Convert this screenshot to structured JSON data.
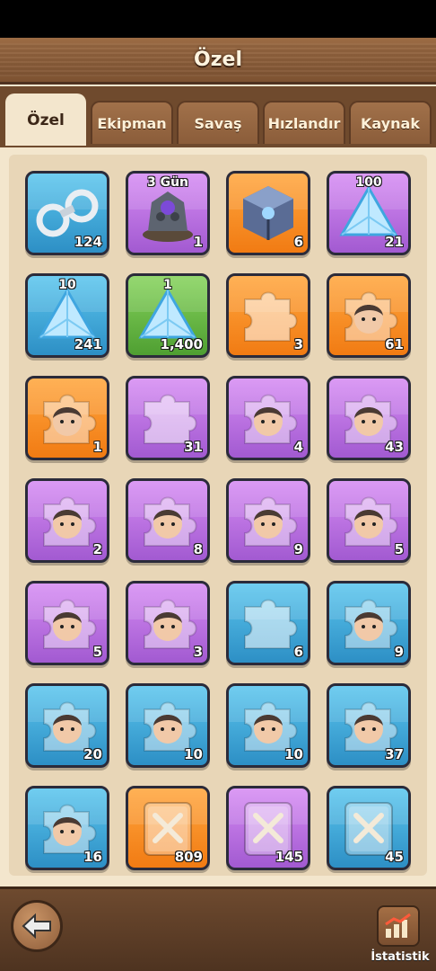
{
  "header": {
    "title": "Özel"
  },
  "tabs": [
    {
      "label": "Özel",
      "active": true
    },
    {
      "label": "Ekipman",
      "active": false
    },
    {
      "label": "Savaş",
      "active": false
    },
    {
      "label": "Hızlandır",
      "active": false
    },
    {
      "label": "Kaynak",
      "active": false
    }
  ],
  "items": [
    {
      "icon": "handcuffs-icon",
      "rarity": "blue",
      "top": "",
      "count": "124"
    },
    {
      "icon": "stone-golem-icon",
      "rarity": "purple",
      "top": "3 Gün",
      "count": "1"
    },
    {
      "icon": "mystery-cube-icon",
      "rarity": "orange",
      "top": "",
      "count": "6"
    },
    {
      "icon": "crystal-icon",
      "rarity": "purple",
      "top": "100",
      "count": "21"
    },
    {
      "icon": "crystal-icon",
      "rarity": "blue",
      "top": "10",
      "count": "241"
    },
    {
      "icon": "crystal-icon",
      "rarity": "green",
      "top": "1",
      "count": "1,400"
    },
    {
      "icon": "puzzle-piece-icon",
      "rarity": "orange",
      "top": "",
      "count": "3"
    },
    {
      "icon": "hero-shard-icon",
      "rarity": "orange",
      "top": "",
      "count": "61"
    },
    {
      "icon": "hero-shard-icon",
      "rarity": "orange",
      "top": "",
      "count": "1"
    },
    {
      "icon": "puzzle-piece-icon",
      "rarity": "purple",
      "top": "",
      "count": "31"
    },
    {
      "icon": "hero-shard-icon",
      "rarity": "purple",
      "top": "",
      "count": "4"
    },
    {
      "icon": "hero-shard-icon",
      "rarity": "purple",
      "top": "",
      "count": "43"
    },
    {
      "icon": "hero-shard-icon",
      "rarity": "purple",
      "top": "",
      "count": "2"
    },
    {
      "icon": "hero-shard-icon",
      "rarity": "purple",
      "top": "",
      "count": "8"
    },
    {
      "icon": "hero-shard-icon",
      "rarity": "purple",
      "top": "",
      "count": "9"
    },
    {
      "icon": "hero-shard-icon",
      "rarity": "purple",
      "top": "",
      "count": "5"
    },
    {
      "icon": "hero-shard-icon",
      "rarity": "purple",
      "top": "",
      "count": "5"
    },
    {
      "icon": "hero-shard-icon",
      "rarity": "purple",
      "top": "",
      "count": "3"
    },
    {
      "icon": "puzzle-piece-icon",
      "rarity": "blue",
      "top": "",
      "count": "6"
    },
    {
      "icon": "hero-shard-icon",
      "rarity": "blue",
      "top": "",
      "count": "9"
    },
    {
      "icon": "hero-shard-icon",
      "rarity": "blue",
      "top": "",
      "count": "20"
    },
    {
      "icon": "hero-shard-icon",
      "rarity": "blue",
      "top": "",
      "count": "10"
    },
    {
      "icon": "hero-shard-icon",
      "rarity": "blue",
      "top": "",
      "count": "10"
    },
    {
      "icon": "hero-shard-icon",
      "rarity": "blue",
      "top": "",
      "count": "37"
    },
    {
      "icon": "hero-shard-icon",
      "rarity": "blue",
      "top": "",
      "count": "16"
    },
    {
      "icon": "skill-book-icon",
      "rarity": "orange",
      "top": "",
      "count": "809"
    },
    {
      "icon": "skill-book-icon",
      "rarity": "purple",
      "top": "",
      "count": "145"
    },
    {
      "icon": "skill-book-icon",
      "rarity": "blue",
      "top": "",
      "count": "45"
    }
  ],
  "colors": {
    "blue": "#2d8fc5",
    "purple": "#a25ad1",
    "orange": "#f17b13",
    "green": "#4f9f32",
    "panel": "#f3e6cd",
    "wood": "#7d5231"
  },
  "footer": {
    "back_icon": "back-arrow-icon",
    "stats_icon": "stats-chart-icon",
    "stats_label": "İstatistik"
  }
}
